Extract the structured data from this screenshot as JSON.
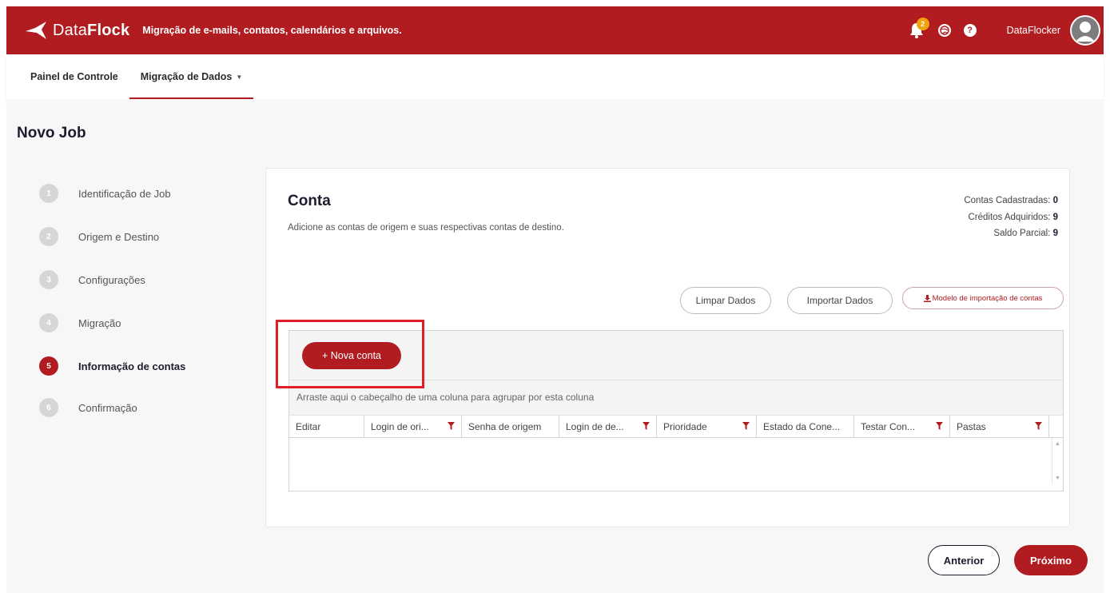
{
  "header": {
    "brand_prefix": "Data",
    "brand_suffix": "Flock",
    "tagline": "Migração de e-mails, contatos, calendários e arquivos.",
    "notification_count": "2",
    "username": "DataFlocker",
    "icons": [
      "logo-icon",
      "bell-icon",
      "globe-icon",
      "help-icon",
      "avatar-icon"
    ]
  },
  "nav": {
    "items": [
      {
        "label": "Painel de Controle"
      },
      {
        "label": "Migração de Dados"
      }
    ],
    "active_index": 1
  },
  "page": {
    "title": "Novo Job"
  },
  "stepper": {
    "steps": [
      {
        "number": "1",
        "label": "Identificação de Job"
      },
      {
        "number": "2",
        "label": "Origem e Destino"
      },
      {
        "number": "3",
        "label": "Configurações"
      },
      {
        "number": "4",
        "label": "Migração"
      },
      {
        "number": "5",
        "label": "Informação de contas"
      },
      {
        "number": "6",
        "label": "Confirmação"
      }
    ],
    "active_index": 4
  },
  "card": {
    "title": "Conta",
    "subtitle": "Adicione as contas de origem e suas respectivas contas de destino.",
    "stats": [
      {
        "label": "Contas Cadastradas:",
        "value": "0"
      },
      {
        "label": "Créditos Adquiridos:",
        "value": "9"
      },
      {
        "label": "Saldo Parcial:",
        "value": "9"
      }
    ],
    "buttons": {
      "clear": "Limpar Dados",
      "import": "Importar Dados",
      "model": "Modelo de importação de contas"
    }
  },
  "grid": {
    "new_account": "+ Nova conta",
    "group_hint": "Arraste aqui o cabeçalho de uma coluna para agrupar por esta coluna",
    "columns": [
      {
        "label": "Editar",
        "filter": false
      },
      {
        "label": "Login de ori...",
        "filter": true
      },
      {
        "label": "Senha de origem",
        "filter": false
      },
      {
        "label": "Login de de...",
        "filter": true
      },
      {
        "label": "Prioridade",
        "filter": true
      },
      {
        "label": "Estado da Cone...",
        "filter": false
      },
      {
        "label": "Testar Con...",
        "filter": true
      },
      {
        "label": "Pastas",
        "filter": true
      }
    ]
  },
  "footer": {
    "prev": "Anterior",
    "next": "Próximo"
  },
  "colors": {
    "brand": "#b01c20",
    "highlight": "#e01e26",
    "badge": "#f0a30a"
  }
}
